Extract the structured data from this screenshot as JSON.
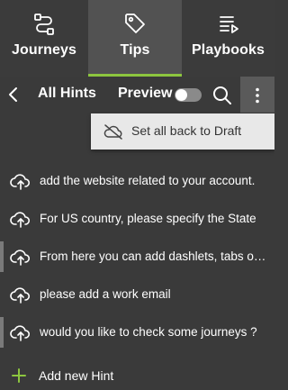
{
  "tabs": [
    {
      "label": "Journeys",
      "icon": "route-icon",
      "active": false
    },
    {
      "label": "Tips",
      "icon": "tag-icon",
      "active": true
    },
    {
      "label": "Playbooks",
      "icon": "list-play-icon",
      "active": false
    }
  ],
  "toolbar": {
    "title": "All Hints",
    "preview_label": "Preview",
    "preview_enabled": false
  },
  "menu": {
    "items": [
      {
        "label": "Set all back to Draft",
        "icon": "cloud-off-icon"
      }
    ]
  },
  "hints": [
    {
      "text": "add the website related to your account.",
      "icon": "cloud-upload-icon",
      "marked": false
    },
    {
      "text": "For US country, please specify the State",
      "icon": "cloud-upload-icon",
      "marked": false
    },
    {
      "text": "From here you can add dashlets, tabs or ...",
      "icon": "cloud-upload-icon",
      "marked": true
    },
    {
      "text": "please add a work email",
      "icon": "cloud-upload-icon",
      "marked": false
    },
    {
      "text": "would you like to check some journeys ?",
      "icon": "cloud-upload-icon",
      "marked": true
    }
  ],
  "add_hint": {
    "label": "Add new Hint",
    "icon": "plus-icon"
  },
  "colors": {
    "background": "#3a3a3a",
    "active_tab": "#525252",
    "accent": "#8dc63f",
    "menu_bg": "#e8e8e8"
  }
}
